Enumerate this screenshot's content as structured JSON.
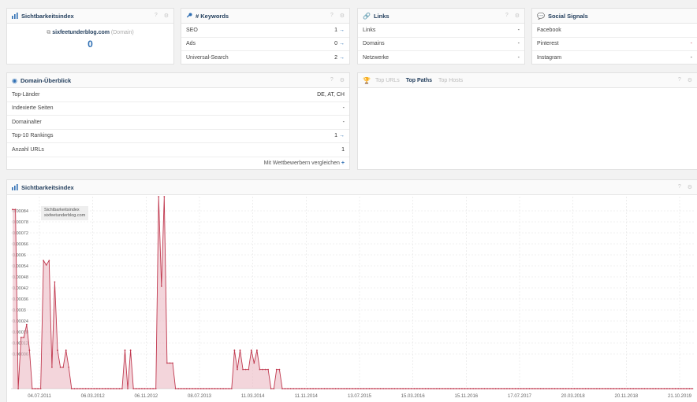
{
  "colors": {
    "accent": "#c0394f",
    "link": "#2f6fb3",
    "title": "#1f3b5a",
    "fill": "#e9b3be"
  },
  "panels": {
    "sichtbarkeit": {
      "title": "Sichtbarkeitsindex",
      "help": "?",
      "gear": "⚙",
      "domain_text": "sixfeetunderblog.com",
      "domain_suffix": "(Domain)",
      "value": "0"
    },
    "keywords": {
      "title": "# Keywords",
      "help": "?",
      "gear": "⚙",
      "rows": [
        {
          "label": "SEO",
          "value": "1"
        },
        {
          "label": "Ads",
          "value": "0"
        },
        {
          "label": "Universal-Search",
          "value": "2"
        }
      ]
    },
    "links": {
      "title": "Links",
      "help": "?",
      "gear": "⚙",
      "rows": [
        {
          "label": "Links",
          "value": "-"
        },
        {
          "label": "Domains",
          "value": "-"
        },
        {
          "label": "Netzwerke",
          "value": "-"
        }
      ]
    },
    "social": {
      "title": "Social Signals",
      "rows": [
        {
          "label": "Facebook",
          "value": ""
        },
        {
          "label": "Pinterest",
          "value": "-"
        },
        {
          "label": "Instagram",
          "value": "-"
        }
      ]
    },
    "overview": {
      "title": "Domain-Überblick",
      "help": "?",
      "gear": "⚙",
      "rows": [
        {
          "label": "Top-Länder",
          "value": "DE, AT, CH"
        },
        {
          "label": "Indexierte Seiten",
          "value": "-"
        },
        {
          "label": "Domainalter",
          "value": "-"
        },
        {
          "label": "Top-10 Rankings",
          "value": "1"
        },
        {
          "label": "Anzahl URLs",
          "value": "1"
        }
      ],
      "compare_label": "Mit Wettbewerbern vergleichen",
      "compare_plus": "+"
    },
    "toppaths": {
      "tabs": [
        "Top URLs",
        "Top Paths",
        "Top Hosts"
      ],
      "active": 1,
      "help": "?",
      "gear": "⚙"
    },
    "chart": {
      "title": "Sichtbarkeitsindex",
      "help": "?",
      "gear": "⚙",
      "legend_title": "Sichtbarkeitsindex",
      "legend_series": "sixfeetunderblog.com"
    }
  },
  "chart_data": {
    "type": "area",
    "y_tick_labels": [
      "0.00084",
      "0.00078",
      "0.00072",
      "0.00066",
      "0.0006",
      "0.00054",
      "0.00048",
      "0.00042",
      "0.00036",
      "0.0003",
      "0.00024",
      "0.00018",
      "0.00012",
      "0.00006"
    ],
    "x_tick_labels": [
      "04.07.2011",
      "06.03.2012",
      "06.11.2012",
      "08.07.2013",
      "11.03.2014",
      "11.11.2014",
      "13.07.2015",
      "15.03.2016",
      "15.11.2016",
      "17.07.2017",
      "20.03.2018",
      "20.11.2018",
      "21.10.2019"
    ],
    "ylim": [
      0,
      0.0009
    ],
    "series": [
      {
        "name": "sixfeetunderblog.com",
        "values": [
          0.00084,
          0.00084,
          0,
          0.00024,
          0.00024,
          0.0003,
          0.00018,
          0,
          0,
          0,
          0,
          0.0006,
          0.00058,
          0.0006,
          0.0001,
          0.0005,
          0.00018,
          0.0001,
          0.0001,
          0.00018,
          0.0001,
          0,
          0,
          0,
          0,
          0,
          0,
          0,
          0,
          0,
          0,
          0,
          0,
          0,
          0,
          0,
          0,
          0,
          0,
          0,
          0.00018,
          0,
          0.00018,
          0,
          0,
          0,
          0,
          0,
          0,
          0,
          0,
          0,
          0.0009,
          0.00048,
          0.0009,
          0.00012,
          0.00012,
          0.00012,
          0,
          0,
          0,
          0,
          0,
          0,
          0,
          0,
          0,
          0,
          0,
          0,
          0,
          0,
          0,
          0,
          0,
          0,
          0,
          0,
          0,
          0.00018,
          9e-05,
          0.00018,
          9e-05,
          9e-05,
          9e-05,
          0.00018,
          0.00012,
          0.00018,
          9e-05,
          9e-05,
          9e-05,
          9e-05,
          0,
          0,
          9e-05,
          9e-05,
          0,
          0,
          0,
          0,
          0,
          0,
          0,
          0,
          0,
          0,
          0,
          0,
          0,
          0,
          0,
          0,
          0,
          0,
          0,
          0,
          0,
          0,
          0,
          0,
          0,
          0,
          0,
          0,
          0,
          0,
          0,
          0,
          0,
          0,
          0,
          0,
          0,
          0,
          0,
          0,
          0,
          0,
          0,
          0,
          0,
          0,
          0,
          0,
          0,
          0,
          0,
          0,
          0,
          0,
          0,
          0,
          0,
          0,
          0,
          0,
          0,
          0,
          0,
          0,
          0,
          0,
          0,
          0,
          0,
          0,
          0,
          0,
          0,
          0,
          0,
          0,
          0,
          0,
          0,
          0,
          0,
          0,
          0,
          0,
          0,
          0,
          0,
          0,
          0,
          0,
          0,
          0,
          0,
          0,
          0,
          0,
          0,
          0,
          0,
          0,
          0,
          0,
          0,
          0,
          0,
          0,
          0,
          0,
          0,
          0,
          0,
          0,
          0,
          0,
          0,
          0,
          0,
          0,
          0,
          0,
          0,
          0,
          0,
          0,
          0,
          0,
          0,
          0,
          0,
          0,
          0,
          0,
          0,
          0,
          0,
          0,
          0,
          0,
          0,
          0,
          0,
          0,
          0,
          0,
          0,
          0,
          0
        ]
      }
    ]
  }
}
